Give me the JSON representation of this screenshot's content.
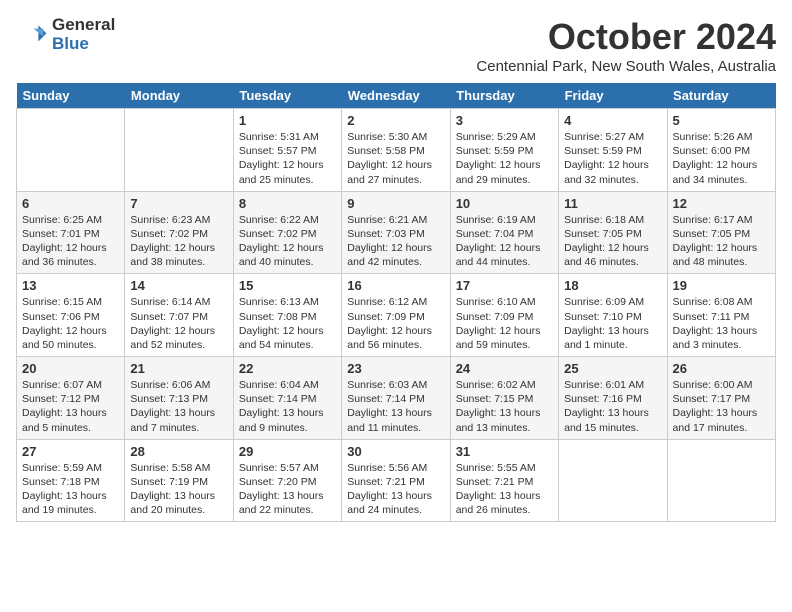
{
  "app": {
    "name": "GeneralBlue",
    "logo_line1": "General",
    "logo_line2": "Blue"
  },
  "calendar": {
    "month": "October 2024",
    "location": "Centennial Park, New South Wales, Australia",
    "days_of_week": [
      "Sunday",
      "Monday",
      "Tuesday",
      "Wednesday",
      "Thursday",
      "Friday",
      "Saturday"
    ],
    "weeks": [
      [
        {
          "day": "",
          "content": ""
        },
        {
          "day": "",
          "content": ""
        },
        {
          "day": "1",
          "content": "Sunrise: 5:31 AM\nSunset: 5:57 PM\nDaylight: 12 hours\nand 25 minutes."
        },
        {
          "day": "2",
          "content": "Sunrise: 5:30 AM\nSunset: 5:58 PM\nDaylight: 12 hours\nand 27 minutes."
        },
        {
          "day": "3",
          "content": "Sunrise: 5:29 AM\nSunset: 5:59 PM\nDaylight: 12 hours\nand 29 minutes."
        },
        {
          "day": "4",
          "content": "Sunrise: 5:27 AM\nSunset: 5:59 PM\nDaylight: 12 hours\nand 32 minutes."
        },
        {
          "day": "5",
          "content": "Sunrise: 5:26 AM\nSunset: 6:00 PM\nDaylight: 12 hours\nand 34 minutes."
        }
      ],
      [
        {
          "day": "6",
          "content": "Sunrise: 6:25 AM\nSunset: 7:01 PM\nDaylight: 12 hours\nand 36 minutes."
        },
        {
          "day": "7",
          "content": "Sunrise: 6:23 AM\nSunset: 7:02 PM\nDaylight: 12 hours\nand 38 minutes."
        },
        {
          "day": "8",
          "content": "Sunrise: 6:22 AM\nSunset: 7:02 PM\nDaylight: 12 hours\nand 40 minutes."
        },
        {
          "day": "9",
          "content": "Sunrise: 6:21 AM\nSunset: 7:03 PM\nDaylight: 12 hours\nand 42 minutes."
        },
        {
          "day": "10",
          "content": "Sunrise: 6:19 AM\nSunset: 7:04 PM\nDaylight: 12 hours\nand 44 minutes."
        },
        {
          "day": "11",
          "content": "Sunrise: 6:18 AM\nSunset: 7:05 PM\nDaylight: 12 hours\nand 46 minutes."
        },
        {
          "day": "12",
          "content": "Sunrise: 6:17 AM\nSunset: 7:05 PM\nDaylight: 12 hours\nand 48 minutes."
        }
      ],
      [
        {
          "day": "13",
          "content": "Sunrise: 6:15 AM\nSunset: 7:06 PM\nDaylight: 12 hours\nand 50 minutes."
        },
        {
          "day": "14",
          "content": "Sunrise: 6:14 AM\nSunset: 7:07 PM\nDaylight: 12 hours\nand 52 minutes."
        },
        {
          "day": "15",
          "content": "Sunrise: 6:13 AM\nSunset: 7:08 PM\nDaylight: 12 hours\nand 54 minutes."
        },
        {
          "day": "16",
          "content": "Sunrise: 6:12 AM\nSunset: 7:09 PM\nDaylight: 12 hours\nand 56 minutes."
        },
        {
          "day": "17",
          "content": "Sunrise: 6:10 AM\nSunset: 7:09 PM\nDaylight: 12 hours\nand 59 minutes."
        },
        {
          "day": "18",
          "content": "Sunrise: 6:09 AM\nSunset: 7:10 PM\nDaylight: 13 hours\nand 1 minute."
        },
        {
          "day": "19",
          "content": "Sunrise: 6:08 AM\nSunset: 7:11 PM\nDaylight: 13 hours\nand 3 minutes."
        }
      ],
      [
        {
          "day": "20",
          "content": "Sunrise: 6:07 AM\nSunset: 7:12 PM\nDaylight: 13 hours\nand 5 minutes."
        },
        {
          "day": "21",
          "content": "Sunrise: 6:06 AM\nSunset: 7:13 PM\nDaylight: 13 hours\nand 7 minutes."
        },
        {
          "day": "22",
          "content": "Sunrise: 6:04 AM\nSunset: 7:14 PM\nDaylight: 13 hours\nand 9 minutes."
        },
        {
          "day": "23",
          "content": "Sunrise: 6:03 AM\nSunset: 7:14 PM\nDaylight: 13 hours\nand 11 minutes."
        },
        {
          "day": "24",
          "content": "Sunrise: 6:02 AM\nSunset: 7:15 PM\nDaylight: 13 hours\nand 13 minutes."
        },
        {
          "day": "25",
          "content": "Sunrise: 6:01 AM\nSunset: 7:16 PM\nDaylight: 13 hours\nand 15 minutes."
        },
        {
          "day": "26",
          "content": "Sunrise: 6:00 AM\nSunset: 7:17 PM\nDaylight: 13 hours\nand 17 minutes."
        }
      ],
      [
        {
          "day": "27",
          "content": "Sunrise: 5:59 AM\nSunset: 7:18 PM\nDaylight: 13 hours\nand 19 minutes."
        },
        {
          "day": "28",
          "content": "Sunrise: 5:58 AM\nSunset: 7:19 PM\nDaylight: 13 hours\nand 20 minutes."
        },
        {
          "day": "29",
          "content": "Sunrise: 5:57 AM\nSunset: 7:20 PM\nDaylight: 13 hours\nand 22 minutes."
        },
        {
          "day": "30",
          "content": "Sunrise: 5:56 AM\nSunset: 7:21 PM\nDaylight: 13 hours\nand 24 minutes."
        },
        {
          "day": "31",
          "content": "Sunrise: 5:55 AM\nSunset: 7:21 PM\nDaylight: 13 hours\nand 26 minutes."
        },
        {
          "day": "",
          "content": ""
        },
        {
          "day": "",
          "content": ""
        }
      ]
    ]
  }
}
